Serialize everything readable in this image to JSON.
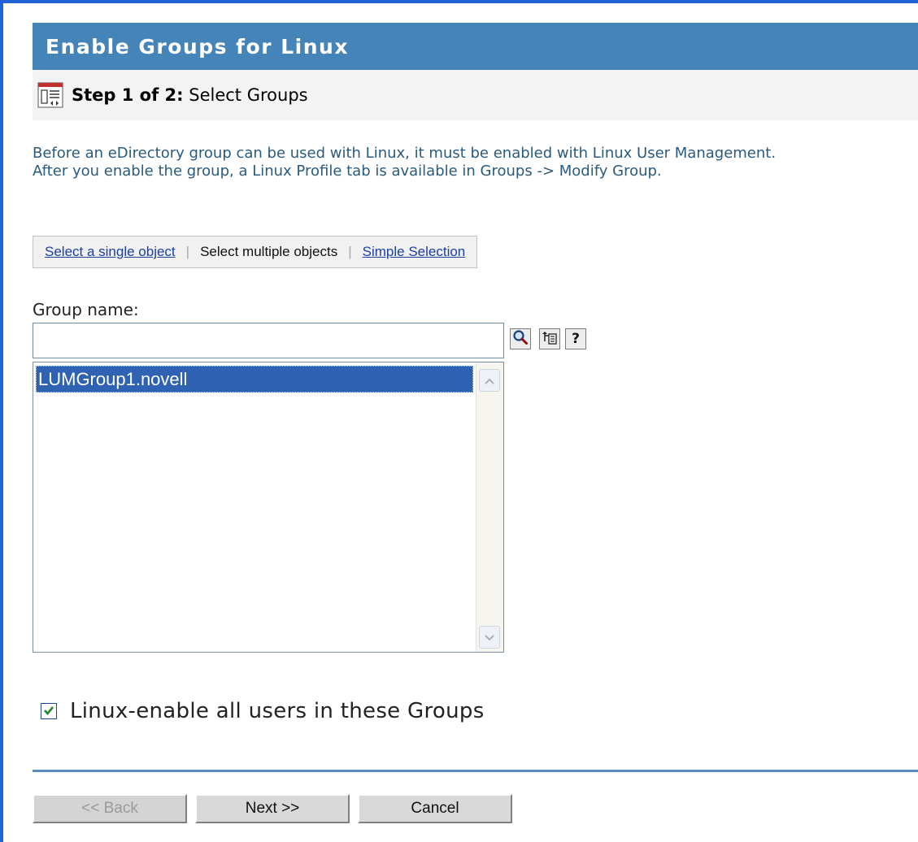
{
  "header": {
    "title": "Enable Groups for Linux",
    "step_prefix": "Step 1 of 2:",
    "step_name": "Select Groups"
  },
  "description": {
    "line1": "Before an eDirectory group can be used with Linux, it must be enabled with Linux User Management.",
    "line2": "After you enable the group, a Linux Profile tab is available in Groups -> Modify Group."
  },
  "selector": {
    "single_label": "Select a single object",
    "multiple_label": "Select multiple objects",
    "simple_label": "Simple Selection",
    "active": "Select multiple objects"
  },
  "group": {
    "label": "Group name:",
    "value": "",
    "items": [
      "LUMGroup1.novell"
    ]
  },
  "tools": {
    "search_icon": "search-icon",
    "tree_icon": "object-browser-icon",
    "help_icon": "help-icon"
  },
  "options": {
    "linux_enable_users_label": "Linux-enable all users in these Groups",
    "linux_enable_users_checked": true
  },
  "buttons": {
    "back_label": "<< Back",
    "next_label": "Next >>",
    "cancel_label": "Cancel",
    "back_disabled": true
  },
  "colors": {
    "frame": "#1f63d6",
    "title_bar": "#4584b8",
    "description_text": "#2a5a7c",
    "link": "#1a3fa8",
    "selection": "#2f62b3",
    "divider": "#5b8fc0"
  }
}
